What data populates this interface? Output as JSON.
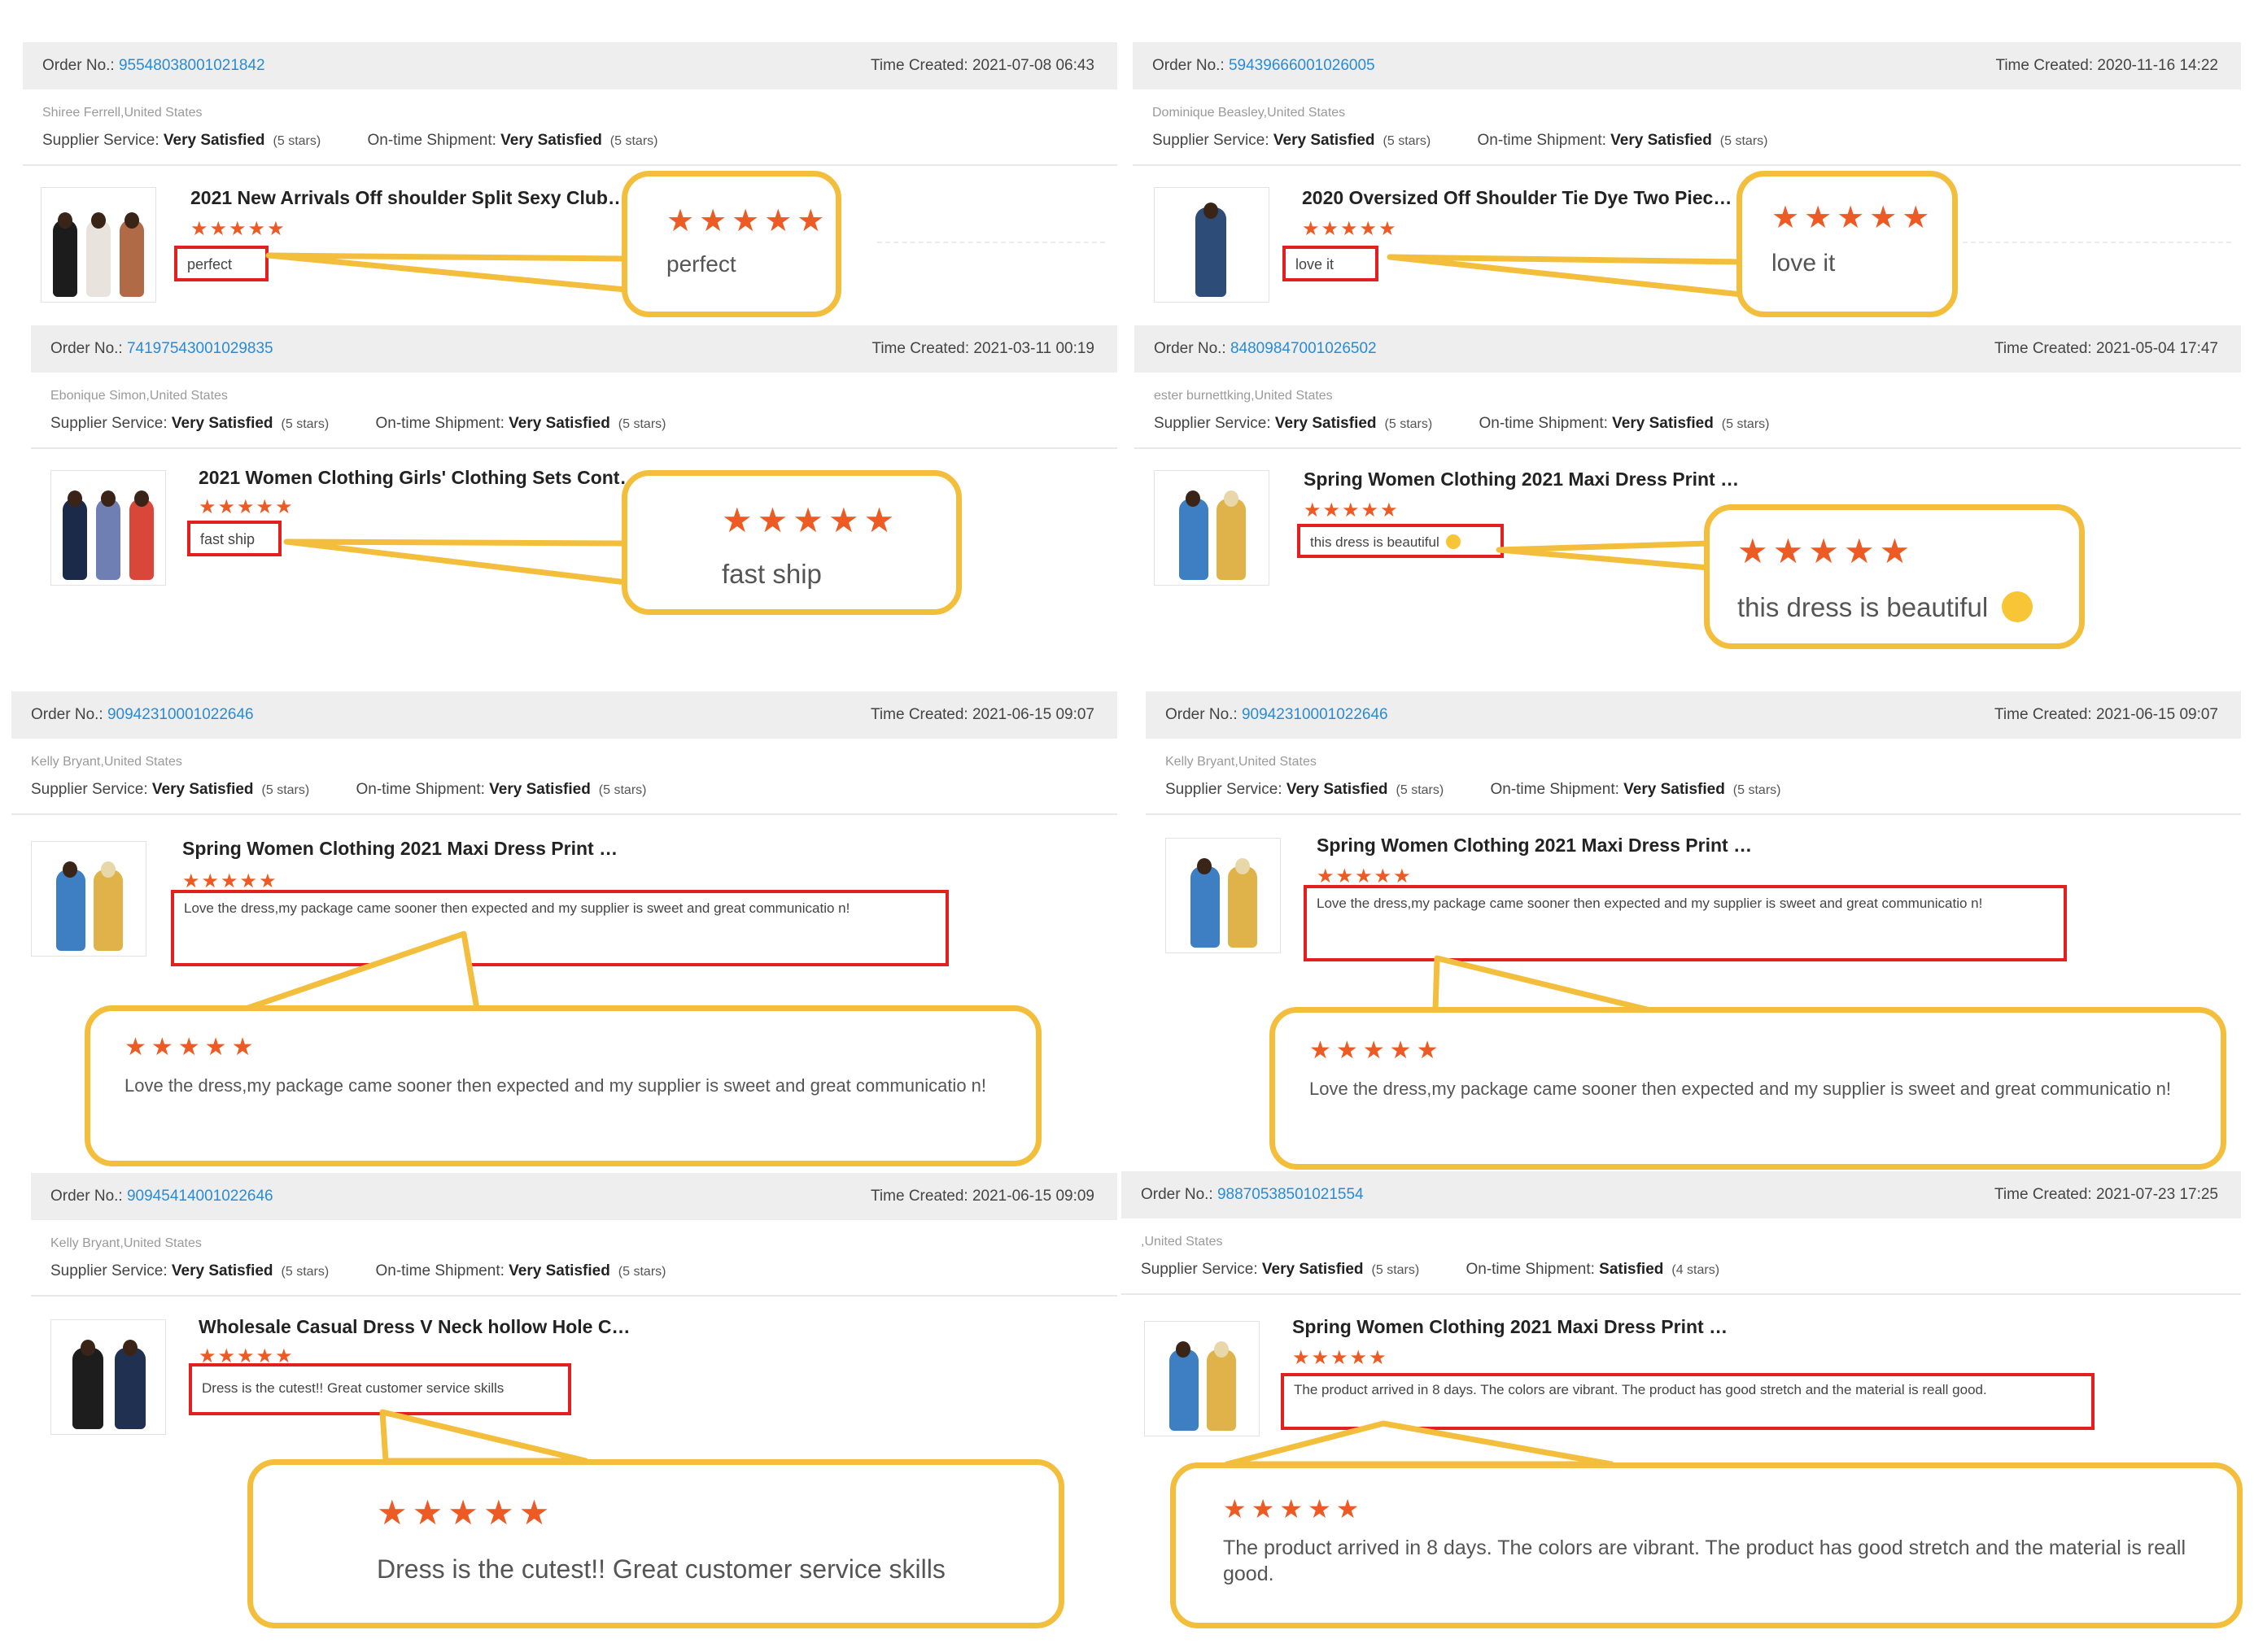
{
  "labels": {
    "order_no": "Order No.:",
    "time_created": "Time Created:",
    "supplier_service": "Supplier Service:",
    "ontime_shipment": "On-time Shipment:"
  },
  "icons": {
    "star": "star-icon",
    "emoji": "star-struck-emoji-icon"
  },
  "colors": {
    "star": "#ee5a24",
    "order_link": "#2a8bd4",
    "highlight_box": "#e32020",
    "callout_border": "#f3be3c"
  },
  "reviews": [
    {
      "order_no": "95548038001021842",
      "time": "2021-07-08 06:43",
      "buyer": "Shiree Ferrell,United States",
      "supplier_value": "Very Satisfied",
      "supplier_stars": "(5 stars)",
      "shipment_value": "Very Satisfied",
      "shipment_stars": "(5 stars)",
      "product_title": "2021 New Arrivals Off shoulder Split Sexy Club…",
      "stars": "★★★★★",
      "review_text": "perfect",
      "callout_stars": "★★★★★",
      "callout_text": "perfect"
    },
    {
      "order_no": "59439666001026005",
      "time": "2020-11-16 14:22",
      "buyer": "Dominique Beasley,United States",
      "supplier_value": "Very Satisfied",
      "supplier_stars": "(5 stars)",
      "shipment_value": "Very Satisfied",
      "shipment_stars": "(5 stars)",
      "product_title": "2020 Oversized Off Shoulder Tie Dye Two Piec…",
      "stars": "★★★★★",
      "review_text": "love it",
      "callout_stars": "★★★★★",
      "callout_text": "love it"
    },
    {
      "order_no": "74197543001029835",
      "time": "2021-03-11 00:19",
      "buyer": "Ebonique Simon,United States",
      "supplier_value": "Very Satisfied",
      "supplier_stars": "(5 stars)",
      "shipment_value": "Very Satisfied",
      "shipment_stars": "(5 stars)",
      "product_title": "2021 Women Clothing Girls' Clothing Sets Cont…",
      "stars": "★★★★★",
      "review_text": "fast ship",
      "callout_stars": "★★★★★",
      "callout_text": "fast ship"
    },
    {
      "order_no": "84809847001026502",
      "time": "2021-05-04 17:47",
      "buyer": "ester burnettking,United States",
      "supplier_value": "Very Satisfied",
      "supplier_stars": "(5 stars)",
      "shipment_value": "Very Satisfied",
      "shipment_stars": "(5 stars)",
      "product_title": "Spring Women Clothing 2021 Maxi Dress Print …",
      "stars": "★★★★★",
      "review_text": "this dress is beautiful",
      "callout_stars": "★★★★★",
      "callout_text": "this dress is beautiful"
    },
    {
      "order_no": "90942310001022646",
      "time": "2021-06-15 09:07",
      "buyer": "Kelly Bryant,United States",
      "supplier_value": "Very Satisfied",
      "supplier_stars": "(5 stars)",
      "shipment_value": "Very Satisfied",
      "shipment_stars": "(5 stars)",
      "product_title": "Spring Women Clothing 2021 Maxi Dress Print …",
      "stars": "★★★★★",
      "review_text": "Love the dress,my package came sooner then expected and my supplier is sweet and  great communicatio n!",
      "callout_stars": "★★★★★",
      "callout_text": "Love the dress,my package came sooner then expected and my supplier is sweet and  great communicatio n!"
    },
    {
      "order_no": "90942310001022646",
      "time": "2021-06-15 09:07",
      "buyer": "Kelly Bryant,United States",
      "supplier_value": "Very Satisfied",
      "supplier_stars": "(5 stars)",
      "shipment_value": "Very Satisfied",
      "shipment_stars": "(5 stars)",
      "product_title": "Spring Women Clothing 2021 Maxi Dress Print …",
      "stars": "★★★★★",
      "review_text": "Love the dress,my package came sooner then expected and my supplier is sweet and  great communicatio n!",
      "callout_stars": "★★★★★",
      "callout_text": "Love the dress,my package came sooner then expected and my supplier is sweet and  great communicatio n!"
    },
    {
      "order_no": "90945414001022646",
      "time": "2021-06-15 09:09",
      "buyer": "Kelly Bryant,United States",
      "supplier_value": "Very Satisfied",
      "supplier_stars": "(5 stars)",
      "shipment_value": "Very Satisfied",
      "shipment_stars": "(5 stars)",
      "product_title": "Wholesale Casual Dress V Neck hollow Hole C…",
      "stars": "★★★★★",
      "review_text": "Dress is the cutest!! Great customer service skills",
      "callout_stars": "★★★★★",
      "callout_text": "Dress is the cutest!! Great customer service skills"
    },
    {
      "order_no": "98870538501021554",
      "time": "2021-07-23 17:25",
      "buyer": ",United States",
      "supplier_value": "Very Satisfied",
      "supplier_stars": "(5 stars)",
      "shipment_value": "Satisfied",
      "shipment_stars": "(4 stars)",
      "product_title": "Spring Women Clothing 2021 Maxi Dress Print …",
      "stars": "★★★★★",
      "review_text": "The product arrived in 8 days. The colors are vibrant. The product has good stretch and the material is reall good.",
      "callout_stars": "★★★★★",
      "callout_text": "The product arrived in 8 days. The colors are vibrant. The product has good stretch and the material is reall good."
    }
  ]
}
